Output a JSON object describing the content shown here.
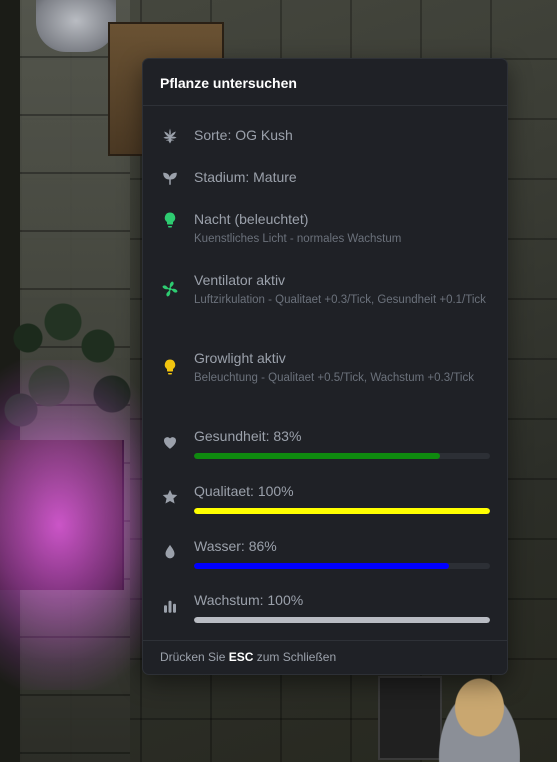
{
  "panel": {
    "title": "Pflanze untersuchen",
    "footer": {
      "prefix": "Drücken Sie",
      "key": "ESC",
      "suffix": "zum Schließen"
    }
  },
  "info": {
    "sorte": {
      "icon": "cannabis-leaf-icon",
      "label": "Sorte: OG Kush"
    },
    "stadium": {
      "icon": "seedling-icon",
      "label": "Stadium: Mature"
    },
    "nacht": {
      "icon": "lightbulb-icon",
      "icon_color": "#2ecc71",
      "label": "Nacht (beleuchtet)",
      "desc": "Kuenstliches Licht - normales Wachstum"
    },
    "ventilator": {
      "icon": "fan-icon",
      "icon_color": "#2ecc71",
      "label": "Ventilator aktiv",
      "desc": "Luftzirkulation - Qualitaet +0.3/Tick, Gesundheit +0.1/Tick"
    },
    "growlight": {
      "icon": "lightbulb-icon",
      "icon_color": "#f1c40f",
      "label": "Growlight aktiv",
      "desc": "Beleuchtung - Qualitaet +0.5/Tick, Wachstum +0.3/Tick"
    }
  },
  "stats": {
    "health": {
      "icon": "heart-icon",
      "label": "Gesundheit: 83%",
      "value": 0.83,
      "color": "#0f8a0f"
    },
    "quality": {
      "icon": "star-icon",
      "label": "Qualitaet: 100%",
      "value": 1.0,
      "color": "#ffff00"
    },
    "water": {
      "icon": "water-drop-icon",
      "label": "Wasser: 86%",
      "value": 0.86,
      "color": "#0000ff"
    },
    "growth": {
      "icon": "bar-chart-icon",
      "label": "Wachstum: 100%",
      "value": 1.0,
      "color": "#b9bcc3"
    }
  },
  "colors": {
    "panel_bg": "#1f2126",
    "label_text": "#9ba1ab",
    "desc_text": "#6b717b",
    "icon_gray": "#9ba1ab"
  }
}
